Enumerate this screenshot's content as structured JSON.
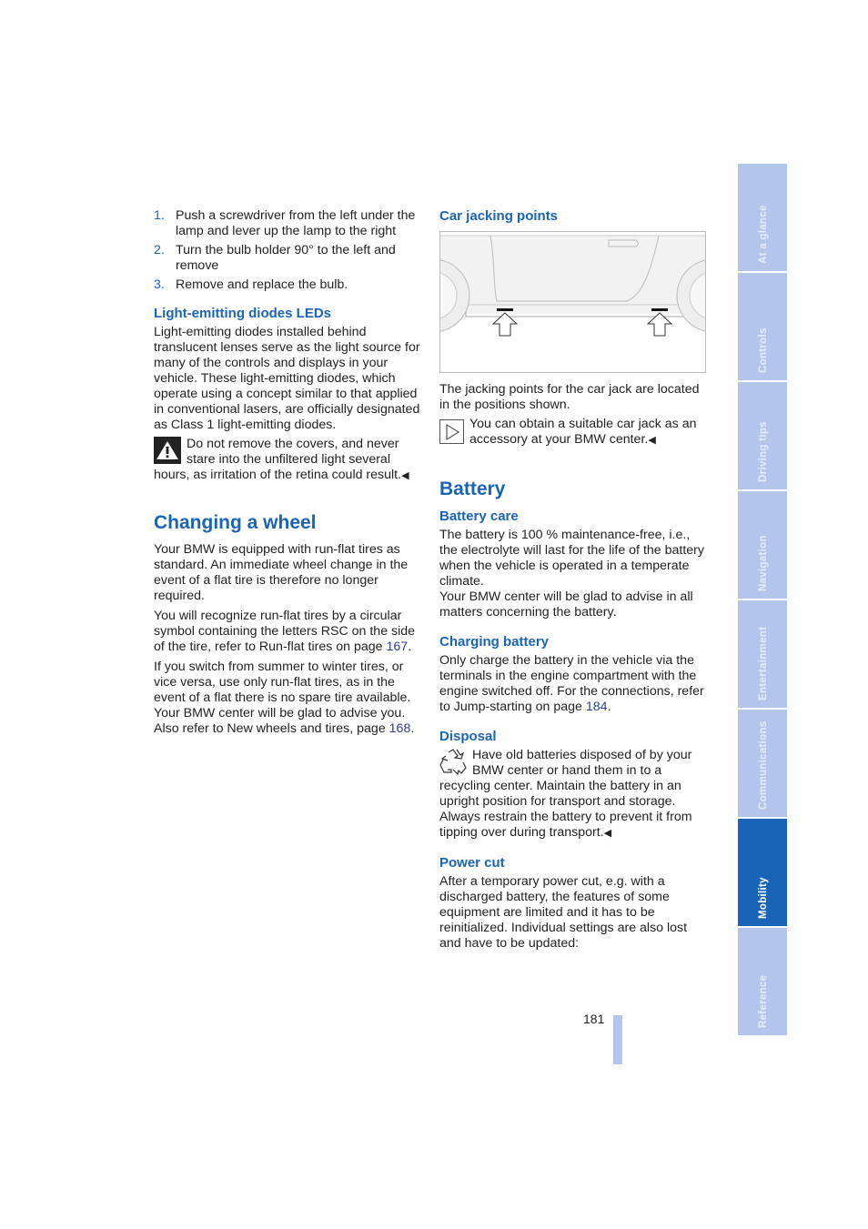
{
  "left_column": {
    "steps": [
      {
        "num": "1.",
        "text": "Push a screwdriver from the left under the lamp and lever up the lamp to the right"
      },
      {
        "num": "2.",
        "text": "Turn the bulb holder 90° to the left and remove"
      },
      {
        "num": "3.",
        "text": "Remove and replace the bulb."
      }
    ],
    "leds": {
      "heading": "Light-emitting diodes LEDs",
      "body": "Light-emitting diodes installed behind translucent lenses serve as the light source for many of the controls and displays in your vehicle. These light-emitting diodes, which operate using a concept similar to that applied in conventional lasers, are officially designated as Class 1 light-emitting diodes.",
      "warning": "Do not remove the covers, and never stare into the unfiltered light several hours, as irritation of the retina could result.",
      "end_mark": "◀"
    },
    "changing_wheel": {
      "heading": "Changing a wheel",
      "para1": "Your BMW is equipped with run-flat tires as standard. An immediate wheel change in the event of a flat tire is therefore no longer required.",
      "para2_text": "You will recognize run-flat tires by a circular symbol containing the letters RSC on the side of the tire, refer to Run-flat tires on page ",
      "para2_link": "167",
      "para3": "If you switch from summer to winter tires, or vice versa, use only run-flat tires, as in the event of a flat there is no spare tire available. Your BMW center will be glad to advise you.",
      "para4_text": "Also refer to New wheels and tires, page ",
      "para4_link": "168"
    }
  },
  "right_column": {
    "jacking": {
      "heading": "Car jacking points",
      "body": "The jacking points for the car jack are located in the positions shown.",
      "note": "You can obtain a suitable car jack as an accessory at your BMW center.",
      "end_mark": "◀"
    },
    "battery": {
      "heading": "Battery",
      "care_heading": "Battery care",
      "care_body1": "The battery is 100 % maintenance-free, i.e., the electrolyte will last for the life of the battery when the vehicle is operated in a temperate climate.",
      "care_body2": "Your BMW center will be glad to advise in all matters concerning the battery.",
      "charging_heading": "Charging battery",
      "charging_text": "Only charge the battery in the vehicle via the terminals in the engine compartment with the engine switched off. For the connections, refer to Jump-starting on page ",
      "charging_link": "184",
      "disposal_heading": "Disposal",
      "disposal_body": "Have old batteries disposed of by your BMW center or hand them in to a recycling center. Maintain the battery in an upright position for transport and storage. Always restrain the battery to prevent it from tipping over during transport.",
      "disposal_end": "◀",
      "power_heading": "Power cut",
      "power_body": "After a temporary power cut, e.g. with a discharged battery, the features of some equipment are limited and it has to be reinitialized. Individual settings are also lost and have to be updated:"
    }
  },
  "sidebar": {
    "tabs": [
      {
        "label": "At a glance",
        "active": false
      },
      {
        "label": "Controls",
        "active": false
      },
      {
        "label": "Driving tips",
        "active": false
      },
      {
        "label": "Navigation",
        "active": false
      },
      {
        "label": "Entertainment",
        "active": false
      },
      {
        "label": "Communications",
        "active": false
      },
      {
        "label": "Mobility",
        "active": true
      },
      {
        "label": "Reference",
        "active": false
      }
    ]
  },
  "footer": {
    "page_number": "181"
  },
  "colors": {
    "accent": "#1a64b8",
    "tab_inactive": "#b4c5eb",
    "link": "#2b3b9c"
  }
}
